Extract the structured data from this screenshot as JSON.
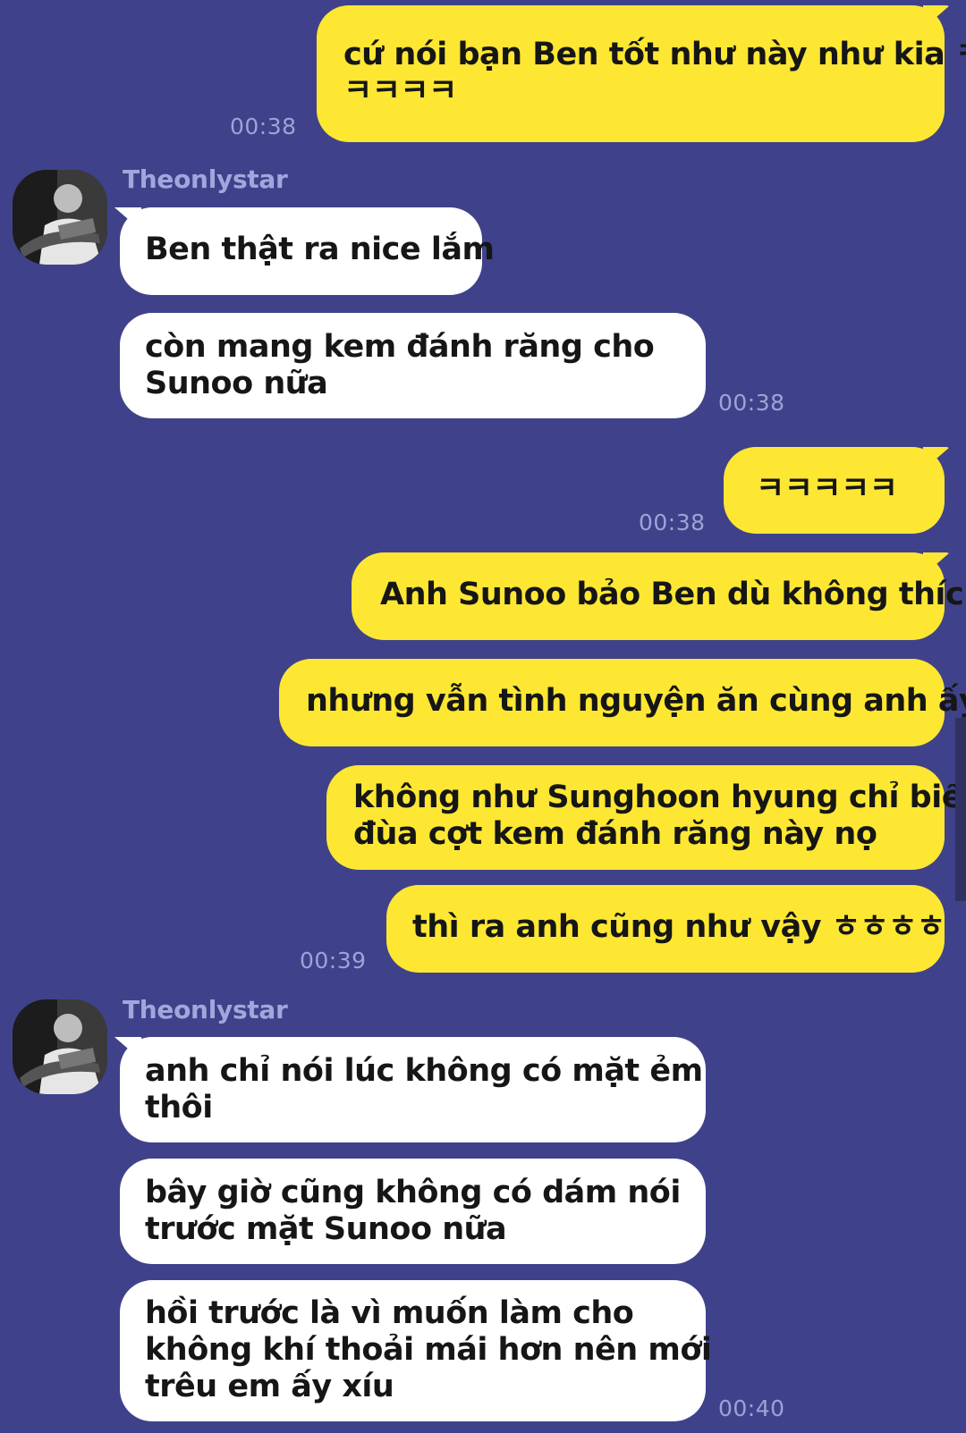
{
  "contact": {
    "name": "Theonlystar",
    "avatar_icon": "contact-avatar"
  },
  "colors": {
    "background": "#3f428a",
    "outgoing_bubble": "#fde733",
    "incoming_bubble": "#ffffff",
    "timestamp": "#9fa2d6",
    "sender_name": "#a3a6dc"
  },
  "messages": [
    {
      "direction": "out",
      "lines": [
        "cứ nói bạn Ben tốt như này như kia ㅋ",
        "ㅋㅋㅋㅋ"
      ],
      "time": "00:38"
    },
    {
      "direction": "in",
      "sender": "Theonlystar",
      "lines": [
        "Ben thật ra nice lắm"
      ]
    },
    {
      "direction": "in",
      "lines": [
        "còn mang kem đánh răng cho",
        "Sunoo nữa"
      ],
      "time": "00:38"
    },
    {
      "direction": "out",
      "lines": [
        "ㅋㅋㅋㅋㅋ"
      ],
      "time": "00:38"
    },
    {
      "direction": "out",
      "lines": [
        "Anh Sunoo bảo Ben dù không thích"
      ]
    },
    {
      "direction": "out",
      "lines": [
        "nhưng vẫn tình nguyện ăn cùng anh ấy"
      ]
    },
    {
      "direction": "out",
      "lines": [
        "không như Sunghoon hyung chỉ biết",
        "đùa cợt kem đánh răng này nọ"
      ]
    },
    {
      "direction": "out",
      "lines": [
        "thì ra anh cũng như vậy ㅎㅎㅎㅎ"
      ],
      "time": "00:39"
    },
    {
      "direction": "in",
      "sender": "Theonlystar",
      "lines": [
        "anh chỉ nói lúc không có mặt ẻm",
        "thôi"
      ]
    },
    {
      "direction": "in",
      "lines": [
        "bây giờ cũng không có dám nói",
        "trước mặt Sunoo nữa"
      ]
    },
    {
      "direction": "in",
      "lines": [
        "hồi trước là vì muốn làm cho",
        "không khí thoải mái hơn nên mới",
        "trêu em ấy xíu"
      ],
      "time": "00:40"
    }
  ]
}
